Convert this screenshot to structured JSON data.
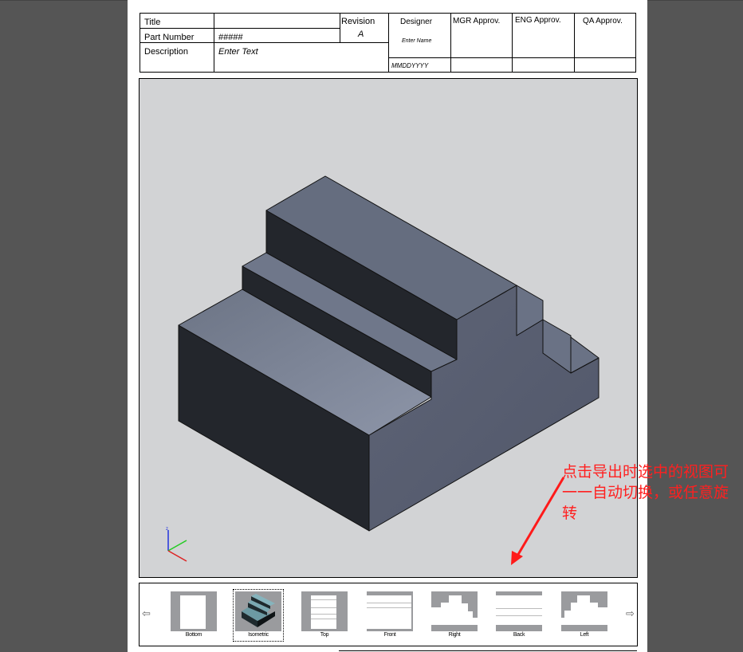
{
  "title_block": {
    "title_label": "Title",
    "title_value": "",
    "part_number_label": "Part Number",
    "part_number_value": "#####",
    "description_label": "Description",
    "description_value": "Enter Text",
    "revision_label": "Revision",
    "revision_value": "A",
    "designer_label": "Designer",
    "designer_value": "Enter Name",
    "date_value": "MMDDYYYY",
    "mgr_label": "MGR Approv.",
    "eng_label": "ENG Approv.",
    "qa_label": "QA Approv."
  },
  "viewport": {
    "background": "#d2d3d5",
    "axis_label": "z",
    "annotation": "点击导出时选中的视图可一一自动切换，或任意旋转",
    "annotation_color": "#ff2020"
  },
  "view_strip": {
    "prev_icon": "⇦",
    "next_icon": "⇨",
    "selected": "Isometric",
    "views": [
      {
        "label": "Bottom"
      },
      {
        "label": "Isometric"
      },
      {
        "label": "Top"
      },
      {
        "label": "Front"
      },
      {
        "label": "Right"
      },
      {
        "label": "Back"
      },
      {
        "label": "Left"
      }
    ]
  }
}
